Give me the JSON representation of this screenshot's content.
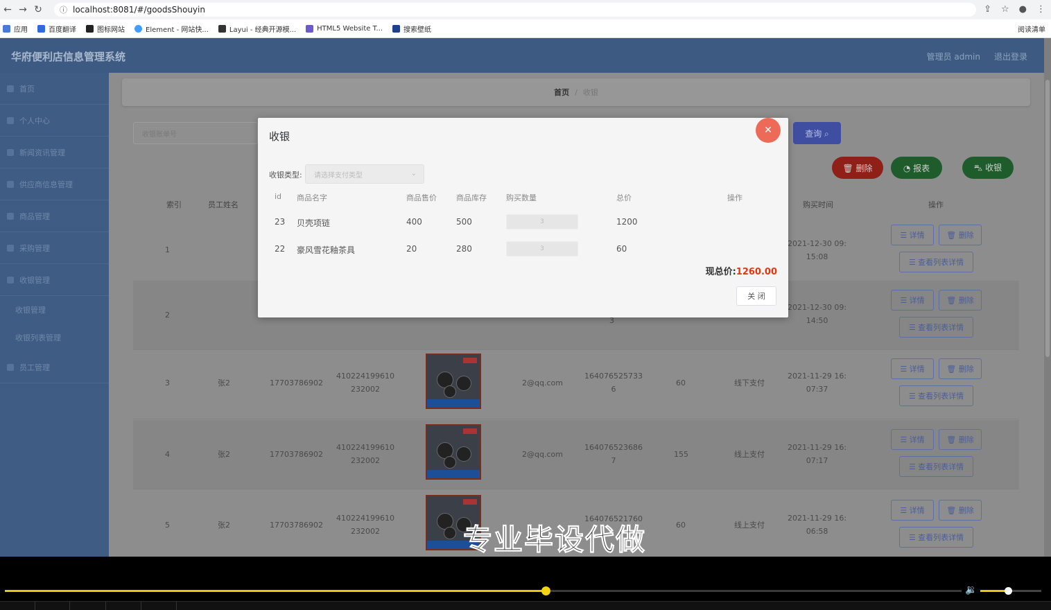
{
  "browser": {
    "url": "localhost:8081/#/goodsShouyin",
    "bookmarks": [
      "应用",
      "百度翻译",
      "图标网站",
      "Element - 网站快...",
      "Layui - 经典开源模...",
      "HTML5 Website T...",
      "搜索壁纸"
    ],
    "reading_list": "阅读清单"
  },
  "app": {
    "title": "华府便利店信息管理系统",
    "user_label": "管理员 admin",
    "logout": "退出登录",
    "sidebar": [
      {
        "label": "首页"
      },
      {
        "label": "个人中心"
      },
      {
        "label": "新闻资讯管理"
      },
      {
        "label": "供应商信息管理"
      },
      {
        "label": "商品管理"
      },
      {
        "label": "采购管理"
      },
      {
        "label": "收银管理"
      }
    ],
    "sidebar_sub": [
      "收银管理",
      "收银列表管理"
    ],
    "sidebar_last": "员工管理",
    "breadcrumb": {
      "home": "首页",
      "sep": "/",
      "current": "收银"
    },
    "search_placeholder": "收银账单号",
    "buttons": {
      "query": "查询 ⌕",
      "delete": "🗑 删除",
      "report": "◔ 报表",
      "cashier": "⛍ 收银"
    },
    "table_headers": [
      "索引",
      "员工姓名",
      "购买时间",
      "操作"
    ],
    "rows": [
      {
        "idx": "1",
        "name": "",
        "phone": "",
        "idcard": "",
        "email": "",
        "bill": "",
        "total": "",
        "pay": "",
        "time": "2021-12-30 09:\n15:08",
        "partial_bill": ""
      },
      {
        "idx": "2",
        "name": "",
        "phone": "",
        "idcard": "",
        "email": "",
        "bill": "3",
        "total": "",
        "pay": "",
        "time": "2021-12-30 09:\n14:50"
      },
      {
        "idx": "3",
        "name": "张2",
        "phone": "17703786902",
        "idcard": "410224199610\n232002",
        "email": "2@qq.com",
        "bill": "164076525733\n6",
        "total": "60",
        "pay": "线下支付",
        "time": "2021-11-29 16:\n07:37"
      },
      {
        "idx": "4",
        "name": "张2",
        "phone": "17703786902",
        "idcard": "410224199610\n232002",
        "email": "2@qq.com",
        "bill": "164076523686\n7",
        "total": "155",
        "pay": "线上支付",
        "time": "2021-11-29 16:\n07:17"
      },
      {
        "idx": "5",
        "name": "张2",
        "phone": "17703786902",
        "idcard": "410224199610\n232002",
        "email": "",
        "bill": "164076521760",
        "total": "60",
        "pay": "线上支付",
        "time": "2021-11-29 16:\n06:58"
      }
    ],
    "row_actions": {
      "detail": "☰ 详情",
      "delete": "🗑 删除",
      "list_detail": "☰ 查看列表详情"
    }
  },
  "modal": {
    "title": "收银",
    "pay_type_label": "收银类型:",
    "pay_type_placeholder": "请选择支付类型",
    "headers": [
      "id",
      "商品名字",
      "商品售价",
      "商品库存",
      "购买数量",
      "总价",
      "操作"
    ],
    "items": [
      {
        "id": "23",
        "name": "贝壳项链",
        "price": "400",
        "stock": "500",
        "qty": "3",
        "total": "1200"
      },
      {
        "id": "22",
        "name": "豪风雪花釉茶具",
        "price": "20",
        "stock": "280",
        "qty": "3",
        "total": "60"
      }
    ],
    "grand_total_label": "现总价:",
    "grand_total_value": "1260.00",
    "close_label": "关 闭"
  },
  "watermark": "专业毕设代做",
  "player": {
    "progress": 0.565,
    "volume": 0.45
  }
}
